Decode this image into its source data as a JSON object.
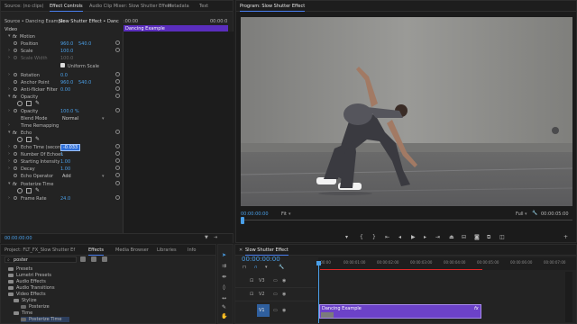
{
  "effect_controls": {
    "tabs": [
      "Source: (no clips)",
      "Effect Controls",
      "Audio Clip Mixer: Slow Shutter Effect",
      "Metadata",
      "Text"
    ],
    "source_clip": "Source • Dancing Example",
    "sequence_clip": "Slow Shutter Effect • Danc",
    "timecode_start": ":00:00",
    "timecode_end": "00:00:0",
    "clip_bar_label": "Dancing Example",
    "section_video": "Video",
    "motion": {
      "fx": "fx",
      "label": "Motion",
      "position_label": "Position",
      "position_x": "960.0",
      "position_y": "540.0",
      "scale_label": "Scale",
      "scale": "100.0",
      "scale_width_label": "Scale Width",
      "scale_width": "100.0",
      "uniform_scale": "Uniform Scale",
      "rotation_label": "Rotation",
      "rotation": "0.0",
      "anchor_label": "Anchor Point",
      "anchor_x": "960.0",
      "anchor_y": "540.0",
      "antiflicker_label": "Anti-flicker Filter",
      "antiflicker": "0.00"
    },
    "opacity": {
      "fx": "fx",
      "label": "Opacity",
      "opacity_label": "Opacity",
      "opacity": "100.0 %",
      "blend_label": "Blend Mode",
      "blend": "Normal"
    },
    "time_remapping": "Time Remapping",
    "echo": {
      "fx": "fx",
      "label": "Echo",
      "echo_time_label": "Echo Time (seconds)",
      "echo_time": "-0.033",
      "num_echoes_label": "Number Of Echoes",
      "num_echoes": "1",
      "start_intensity_label": "Starting Intensity",
      "start_intensity": "1.00",
      "decay_label": "Decay",
      "decay": "1.00",
      "operator_label": "Echo Operator",
      "operator": "Add"
    },
    "posterize": {
      "fx": "fx",
      "label": "Posterize Time",
      "frame_rate_label": "Frame Rate",
      "frame_rate": "24.0"
    },
    "bottom_timecode": "00:00:00:00"
  },
  "program": {
    "tab": "Program: Slow Shutter Effect",
    "timecode": "00:00:00:00",
    "fit": "Fit",
    "quality": "Full",
    "duration": "00:00:05:00"
  },
  "effects_panel": {
    "tabs": [
      "Project: FLT_FX_Slow Shutter Ef",
      "Effects",
      "Media Browser",
      "Libraries",
      "Info"
    ],
    "search_value": "poster",
    "tree": [
      "Presets",
      "Lumetri Presets",
      "Audio Effects",
      "Audio Transitions",
      "Video Effects",
      "Stylize",
      "Posterize",
      "Time",
      "Posterize Time"
    ]
  },
  "timeline": {
    "tab": "Slow Shutter Effect",
    "timecode": "00:00:00:00",
    "ruler": [
      ":00:00",
      "00:00:01:00",
      "00:00:02:00",
      "00:00:03:00",
      "00:00:04:00",
      "00:00:05:00",
      "00:00:06:00",
      "00:00:07:00"
    ],
    "tracks": [
      "V3",
      "V2",
      "V1"
    ],
    "clip_label": "Dancing Example",
    "clip_fx": "fx"
  },
  "colors": {
    "accent_blue": "#4a9fe8",
    "clip_purple": "#6c42c8",
    "red_line": "#e02828"
  }
}
